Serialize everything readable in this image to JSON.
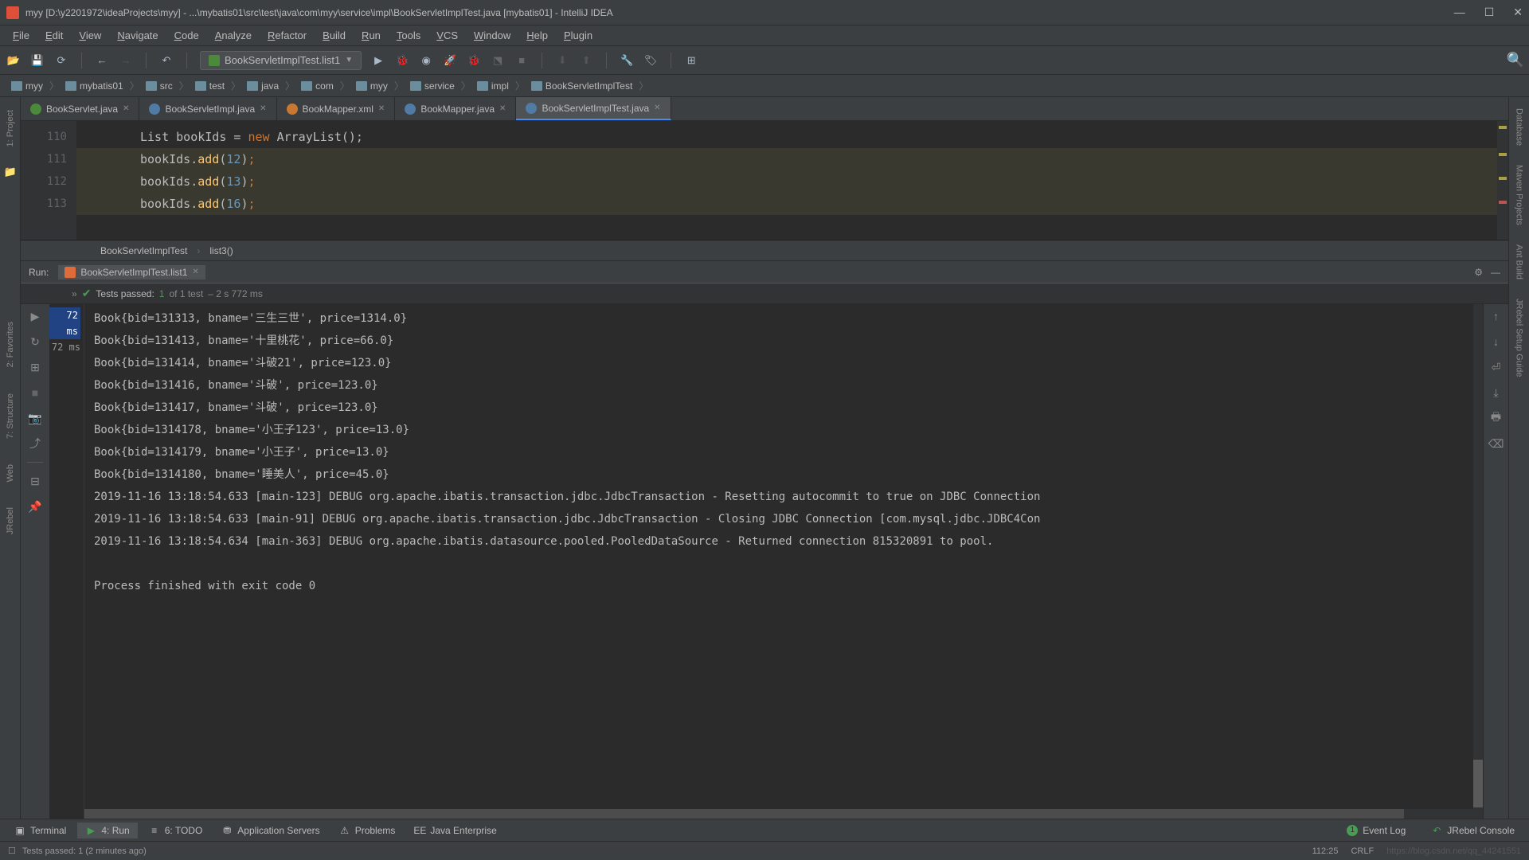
{
  "window": {
    "title": "myy [D:\\y2201972\\ideaProjects\\myy] - ...\\mybatis01\\src\\test\\java\\com\\myy\\service\\impl\\BookServletImplTest.java [mybatis01] - IntelliJ IDEA"
  },
  "menu": {
    "items": [
      "File",
      "Edit",
      "View",
      "Navigate",
      "Code",
      "Analyze",
      "Refactor",
      "Build",
      "Run",
      "Tools",
      "VCS",
      "Window",
      "Help",
      "Plugin"
    ]
  },
  "toolbar": {
    "run_config": "BookServletImplTest.list1"
  },
  "breadcrumb": {
    "items": [
      "myy",
      "mybatis01",
      "src",
      "test",
      "java",
      "com",
      "myy",
      "service",
      "impl",
      "BookServletImplTest"
    ]
  },
  "editor_tabs": [
    {
      "label": "BookServlet.java",
      "icon": "fi-class",
      "active": false
    },
    {
      "label": "BookServletImpl.java",
      "icon": "fi-class-i",
      "active": false
    },
    {
      "label": "BookMapper.xml",
      "icon": "fi-xml",
      "active": false
    },
    {
      "label": "BookMapper.java",
      "icon": "fi-class-i",
      "active": false
    },
    {
      "label": "BookServletImplTest.java",
      "icon": "fi-class-i",
      "active": true
    }
  ],
  "code": {
    "lines": [
      {
        "n": "110",
        "html": "List bookIds = <span class='kw'>new</span> ArrayList();"
      },
      {
        "n": "111",
        "html": "bookIds.<span class='fn'>add</span>(<span class='num'>12</span>)<span class='sem'>;</span>"
      },
      {
        "n": "112",
        "html": "bookIds.<span class='fn'>add</span>(<span class='num'>13</span>)<span class='sem'>;</span>"
      },
      {
        "n": "113",
        "html": "bookIds.<span class='fn'>add</span>(<span class='num'>16</span>)<span class='sem'>;</span>"
      }
    ]
  },
  "crumb_nav": {
    "class": "BookServletImplTest",
    "method": "list3()"
  },
  "run": {
    "title": "Run:",
    "tab": "BookServletImplTest.list1",
    "status_prefix": "Tests passed: ",
    "status_count": "1",
    "status_of": " of 1 test",
    "status_time": " – 2 s 772 ms",
    "left_times": [
      "72 ms",
      "72 ms"
    ],
    "console_lines": [
      "Book{bid=131313, bname='三生三世', price=1314.0}",
      "Book{bid=131413, bname='十里桃花', price=66.0}",
      "Book{bid=131414, bname='斗破21', price=123.0}",
      "Book{bid=131416, bname='斗破', price=123.0}",
      "Book{bid=131417, bname='斗破', price=123.0}",
      "Book{bid=1314178, bname='小王子123', price=13.0}",
      "Book{bid=1314179, bname='小王子', price=13.0}",
      "Book{bid=1314180, bname='睡美人', price=45.0}",
      "2019-11-16 13:18:54.633 [main-123] DEBUG org.apache.ibatis.transaction.jdbc.JdbcTransaction - Resetting autocommit to true on JDBC Connection",
      "2019-11-16 13:18:54.633 [main-91] DEBUG org.apache.ibatis.transaction.jdbc.JdbcTransaction - Closing JDBC Connection [com.mysql.jdbc.JDBC4Con",
      "2019-11-16 13:18:54.634 [main-363] DEBUG org.apache.ibatis.datasource.pooled.PooledDataSource - Returned connection 815320891 to pool.",
      "",
      "Process finished with exit code 0"
    ]
  },
  "left_sidebar": {
    "project": "1: Project",
    "favorites": "2: Favorites",
    "structure": "7: Structure",
    "web": "Web",
    "jrebel": "JRebel"
  },
  "right_sidebar": {
    "database": "Database",
    "maven": "Maven Projects",
    "ant": "Ant Build",
    "jrebel": "JRebel Setup Guide"
  },
  "bottom": {
    "terminal": "Terminal",
    "run": "4: Run",
    "todo": "6: TODO",
    "appservers": "Application Servers",
    "problems": "Problems",
    "javaee": "Java Enterprise",
    "event_count": "1",
    "event_log": "Event Log",
    "jrebel": "JRebel Console"
  },
  "status": {
    "left": "Tests passed: 1 (2 minutes ago)",
    "pos": "112:25",
    "encoding": "CRLF",
    "watermark": "https://blog.csdn.net/qq_44241551"
  }
}
